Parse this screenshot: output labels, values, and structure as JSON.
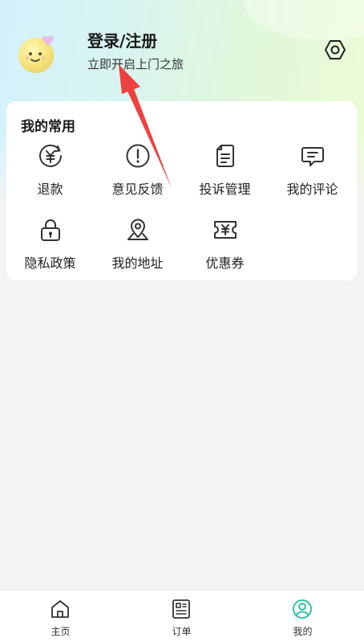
{
  "profile": {
    "title": "登录/注册",
    "subtitle": "立即开启上门之旅",
    "avatar_icon": "smiley-avatar-icon",
    "settings_icon": "hexagon-settings-icon"
  },
  "common": {
    "title": "我的常用",
    "items": [
      {
        "label": "退款",
        "icon": "yuan-refund-icon"
      },
      {
        "label": "意见反馈",
        "icon": "exclamation-circle-icon"
      },
      {
        "label": "投诉管理",
        "icon": "document-icon"
      },
      {
        "label": "我的评论",
        "icon": "comment-icon"
      },
      {
        "label": "隐私政策",
        "icon": "lock-icon"
      },
      {
        "label": "我的地址",
        "icon": "location-pin-icon"
      },
      {
        "label": "优惠券",
        "icon": "coupon-icon"
      }
    ]
  },
  "tabbar": {
    "items": [
      {
        "label": "主页",
        "icon": "home-icon",
        "active": false
      },
      {
        "label": "订单",
        "icon": "order-list-icon",
        "active": false
      },
      {
        "label": "我的",
        "icon": "user-profile-icon",
        "active": true
      }
    ]
  },
  "colors": {
    "accent": "#1dbf9c",
    "annotation_arrow": "#f04141",
    "icon_stroke": "#333333"
  }
}
